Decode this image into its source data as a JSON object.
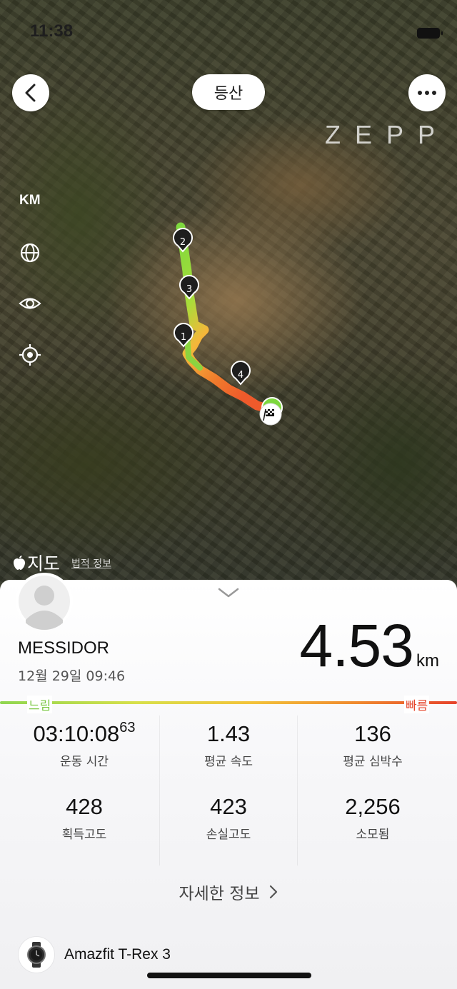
{
  "status_bar": {
    "time": "11:38"
  },
  "header": {
    "activity_type": "등산",
    "brand": "ZEPP"
  },
  "map_controls": {
    "unit_toggle": "KM"
  },
  "map_attribution": {
    "maps_label": "지도",
    "legal_label": "법적 정보"
  },
  "route": {
    "markers": [
      "1",
      "2",
      "3",
      "4"
    ]
  },
  "summary": {
    "user_name": "MESSIDOR",
    "datetime": "12월 29일 09:46",
    "distance_value": "4.53",
    "distance_unit": "km"
  },
  "speed_legend": {
    "slow": "느림",
    "fast": "빠름"
  },
  "stats": {
    "duration_main": "03:10:08",
    "duration_fraction": "63",
    "duration_label": "운동 시간",
    "avg_speed_value": "1.43",
    "avg_speed_label": "평균 속도",
    "avg_hr_value": "136",
    "avg_hr_label": "평균 심박수",
    "elev_gain_value": "428",
    "elev_gain_label": "획득고도",
    "elev_loss_value": "423",
    "elev_loss_label": "손실고도",
    "calories_value": "2,256",
    "calories_label": "소모됨"
  },
  "detail_link": {
    "label": "자세한 정보"
  },
  "device": {
    "name": "Amazfit T-Rex 3"
  },
  "colors": {
    "slow": "#7cc845",
    "fast": "#e5472d",
    "route_mid": "#f08a2e"
  }
}
